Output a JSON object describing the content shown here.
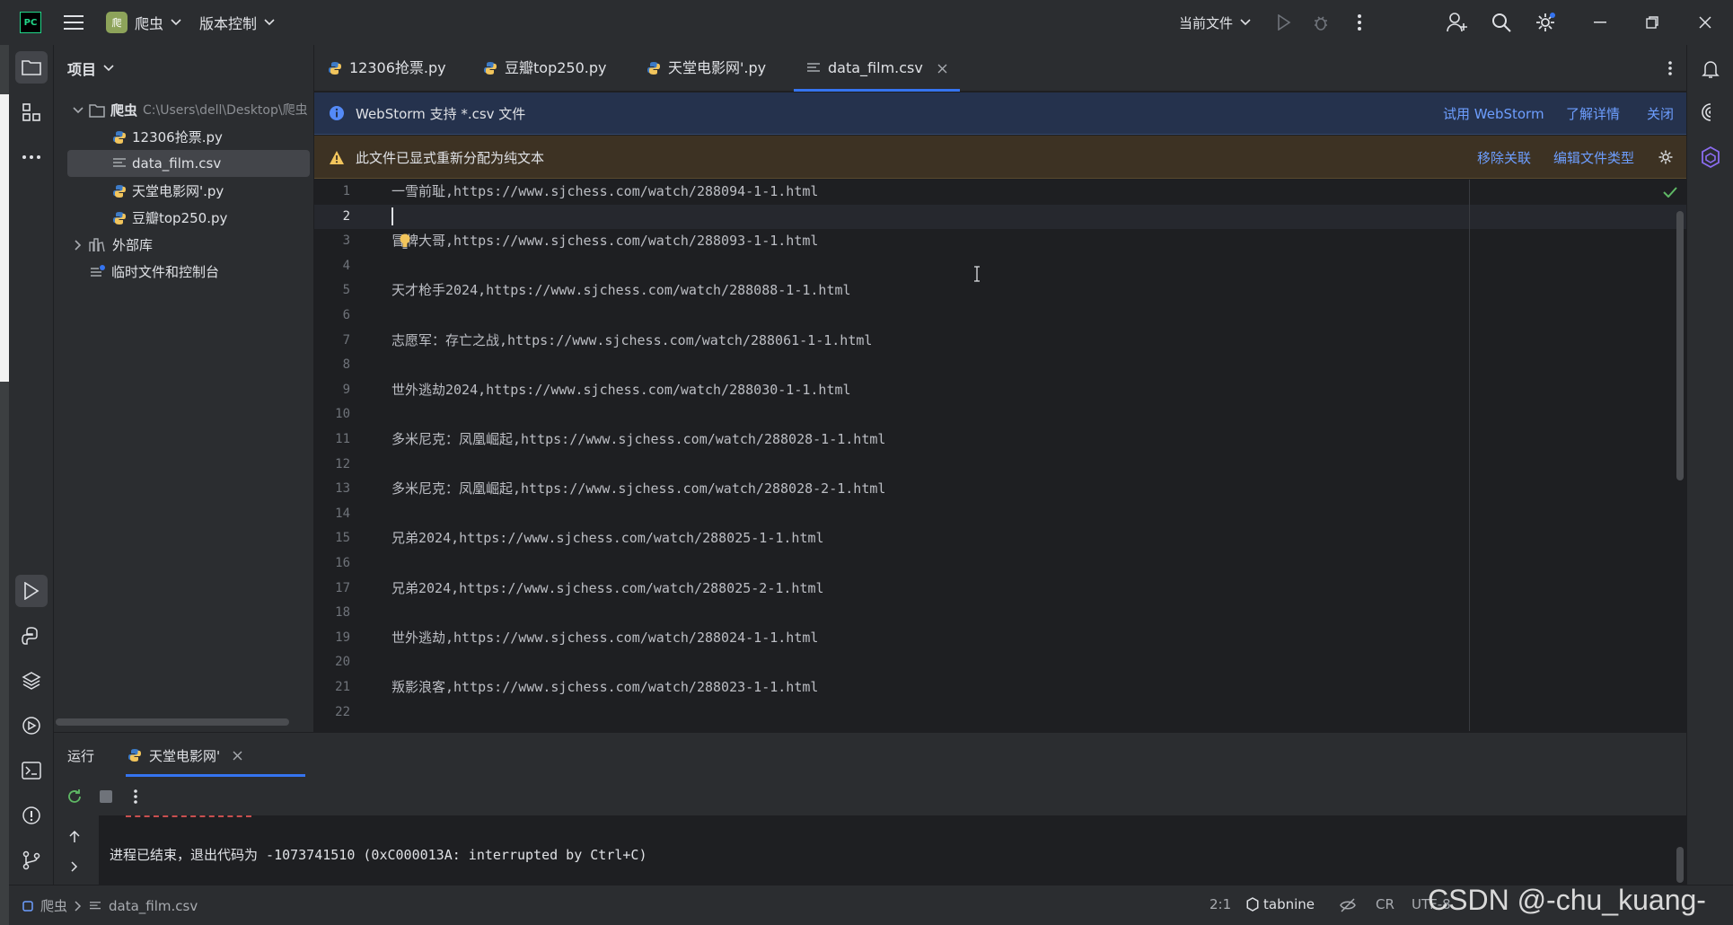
{
  "titlebar": {
    "app_badge": "PC",
    "project_badge": "爬",
    "project_name": "爬虫",
    "vcs_menu": "版本控制",
    "run_config": "当前文件"
  },
  "project_panel": {
    "title": "项目",
    "root_name": "爬虫",
    "root_path": "C:\\Users\\dell\\Desktop\\爬虫",
    "files": [
      {
        "name": "12306抢票.py"
      },
      {
        "name": "data_film.csv"
      },
      {
        "name": "天堂电影网'.py"
      },
      {
        "name": "豆瓣top250.py"
      }
    ],
    "external_libs": "外部库",
    "scratches": "临时文件和控制台"
  },
  "tabs": [
    {
      "label": "12306抢票.py"
    },
    {
      "label": "豆瓣top250.py"
    },
    {
      "label": "天堂电影网'.py"
    },
    {
      "label": "data_film.csv"
    }
  ],
  "banner_info": {
    "text": "WebStorm 支持 *.csv 文件",
    "link_try": "试用 WebStorm",
    "link_details": "了解详情",
    "link_close": "关闭"
  },
  "banner_warn": {
    "text": "此文件已显式重新分配为纯文本",
    "link_remove": "移除关联",
    "link_edit": "编辑文件类型"
  },
  "editor": {
    "line_numbers": [
      "1",
      "2",
      "3",
      "4",
      "5",
      "6",
      "7",
      "8",
      "9",
      "10",
      "11",
      "12",
      "13",
      "14",
      "15",
      "16",
      "17",
      "18",
      "19",
      "20",
      "21",
      "22"
    ],
    "lines": [
      "一雪前耻,https://www.sjchess.com/watch/288094-1-1.html",
      "",
      "冒牌大哥,https://www.sjchess.com/watch/288093-1-1.html",
      "",
      "天才枪手2024,https://www.sjchess.com/watch/288088-1-1.html",
      "",
      "志愿军：存亡之战,https://www.sjchess.com/watch/288061-1-1.html",
      "",
      "世外逃劫2024,https://www.sjchess.com/watch/288030-1-1.html",
      "",
      "多米尼克：凤凰崛起,https://www.sjchess.com/watch/288028-1-1.html",
      "",
      "多米尼克：凤凰崛起,https://www.sjchess.com/watch/288028-2-1.html",
      "",
      "兄弟2024,https://www.sjchess.com/watch/288025-1-1.html",
      "",
      "兄弟2024,https://www.sjchess.com/watch/288025-2-1.html",
      "",
      "世外逃劫,https://www.sjchess.com/watch/288024-1-1.html",
      "",
      "叛影浪客,https://www.sjchess.com/watch/288023-1-1.html",
      ""
    ]
  },
  "run_panel": {
    "title": "运行",
    "tab_label": "天堂电影网'",
    "console_output": "进程已结束，退出代码为 -1073741510 (0xC000013A: interrupted by Ctrl+C)"
  },
  "statusbar": {
    "breadcrumb_project": "爬虫",
    "breadcrumb_file": "data_film.csv",
    "position": "2:1",
    "tabnine": "tabnine",
    "line_sep": "CR",
    "encoding": "UTF-8",
    "watermark": "CSDN @-chu_kuang-"
  },
  "colors": {
    "accent": "#3574f0",
    "info_banner": "#25324d",
    "warn_banner": "#3d3223",
    "link": "#6d9eff",
    "warn_icon": "#f2c55c"
  }
}
